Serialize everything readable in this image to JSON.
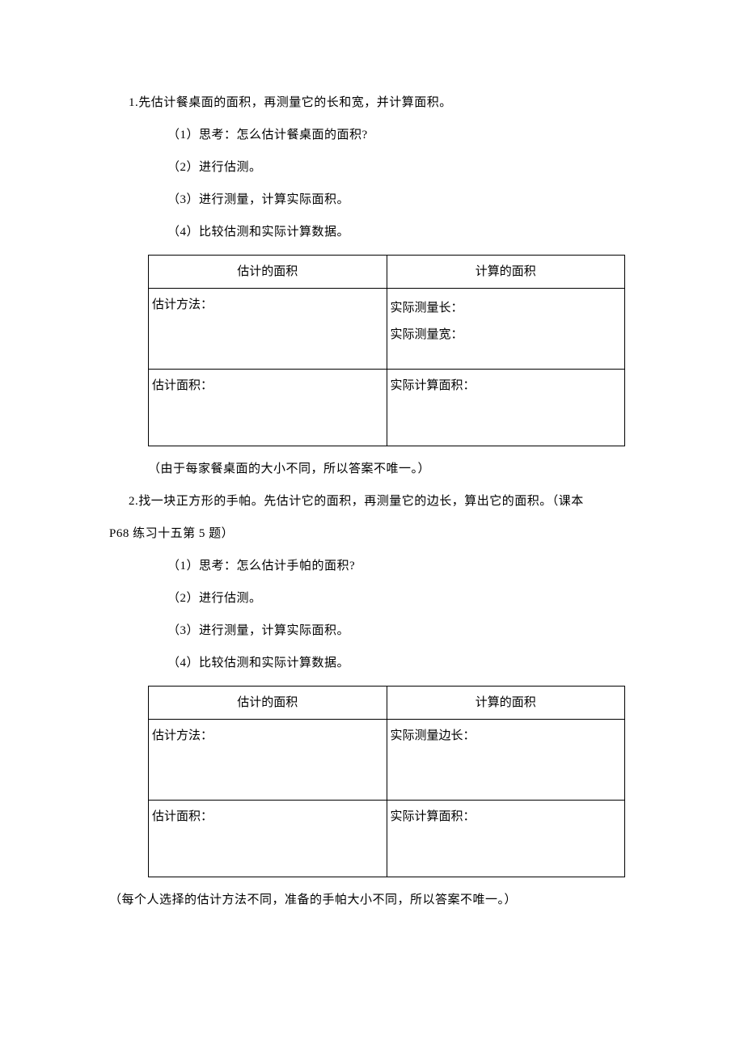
{
  "q1": {
    "title": "1.先估计餐桌面的面积，再测量它的长和宽，并计算面积。",
    "steps": [
      "（1）思考：怎么估计餐桌面的面积?",
      "（2）进行估测。",
      "（3）进行测量，计算实际面积。",
      "（4）比较估测和实际计算数据。"
    ],
    "table": {
      "headers": [
        "估计的面积",
        "计算的面积"
      ],
      "row1": {
        "left": "估计方法：",
        "right_a": "实际测量长：",
        "right_b": "实际测量宽："
      },
      "row2": {
        "left": "估计面积：",
        "right": "实际计算面积："
      }
    },
    "note": "（由于每家餐桌面的大小不同，所以答案不唯一。）"
  },
  "q2": {
    "title_line1": "2.找一块正方形的手帕。先估计它的面积，再测量它的边长，算出它的面积。（课本",
    "title_line2": "P68 练习十五第 5 题）",
    "steps": [
      "（1）思考：怎么估计手帕的面积?",
      "（2）进行估测。",
      "（3）进行测量，计算实际面积。",
      "（4）比较估测和实际计算数据。"
    ],
    "table": {
      "headers": [
        "估计的面积",
        "计算的面积"
      ],
      "row1": {
        "left": "估计方法：",
        "right": "实际测量边长："
      },
      "row2": {
        "left": "估计面积：",
        "right": "实际计算面积："
      }
    },
    "note": "（每个人选择的估计方法不同，准备的手帕大小不同，所以答案不唯一。）"
  }
}
